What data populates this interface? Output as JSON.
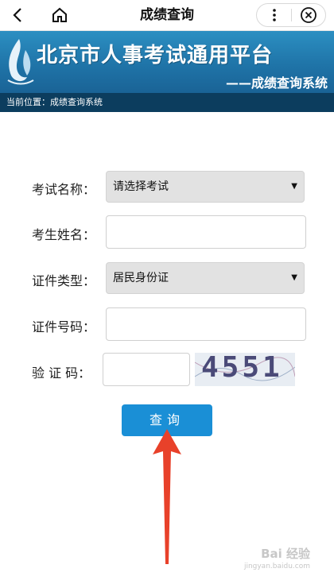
{
  "nav": {
    "title": "成绩查询",
    "back_icon": "chevron-left-icon",
    "home_icon": "home-icon",
    "more_icon": "more-vertical-icon",
    "close_icon": "close-circle-icon"
  },
  "banner": {
    "title": "北京市人事考试通用平台",
    "subtitle": "——成绩查询系统",
    "breadcrumb": "当前位置：成绩查询系统"
  },
  "form": {
    "exam_label": "考试名称：",
    "exam_value": "请选择考试",
    "name_label": "考生姓名：",
    "name_value": "",
    "id_type_label": "证件类型：",
    "id_type_value": "居民身份证",
    "id_no_label": "证件号码：",
    "id_no_value": "",
    "captcha_label": "验 证 码：",
    "captcha_value": "",
    "captcha_image_text": "4551",
    "submit_label": "查询"
  },
  "watermark": {
    "text": "Bai 经验",
    "url": "jingyan.baidu.com"
  },
  "colors": {
    "banner": "#1f74a8",
    "crumb_bar": "#0c3d5e",
    "button": "#1a8fd6",
    "arrow": "#e8412a"
  }
}
